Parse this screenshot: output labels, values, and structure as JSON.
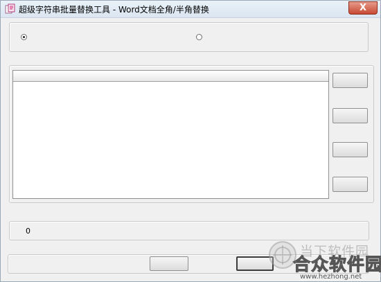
{
  "window": {
    "title": "超级字符串批量替换工具 - Word文档全角/半角替换",
    "close_glyph": "X"
  },
  "status": {
    "count": "0"
  },
  "watermark": {
    "top_text": "当下软件园",
    "main_text": "合众软件园",
    "url": "www.hezhong.net"
  }
}
